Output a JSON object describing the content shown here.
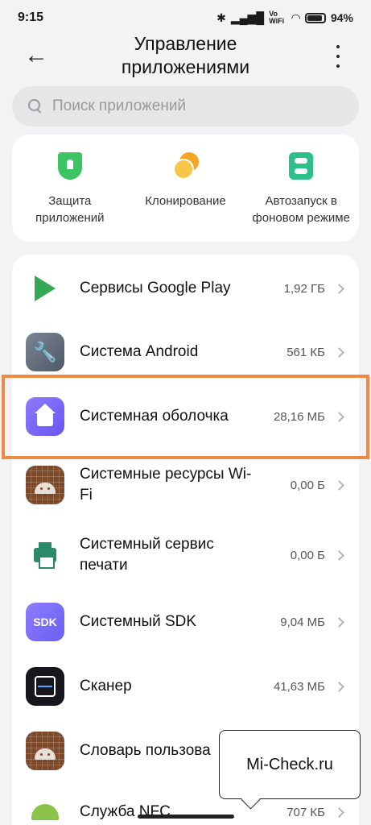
{
  "status_bar": {
    "time": "9:15",
    "network": "Vo WiFi",
    "battery": "94%"
  },
  "header": {
    "title": "Управление приложениями",
    "back_icon": "arrow-left-icon",
    "more_icon": "more-vertical-icon"
  },
  "search": {
    "placeholder": "Поиск приложений"
  },
  "quick_actions": [
    {
      "label": "Защита приложений",
      "icon": "shield-lock-icon",
      "color": "#3cc464"
    },
    {
      "label": "Клонирование",
      "icon": "clone-icon",
      "color": "#f5a623"
    },
    {
      "label": "Автозапуск в фоновом режиме",
      "icon": "autostart-icon",
      "color": "#2fbf8a"
    }
  ],
  "apps": [
    {
      "name": "Сервисы Google Play",
      "size": "1,92 ГБ"
    },
    {
      "name": "Система Android",
      "size": "561 КБ"
    },
    {
      "name": "Системная оболочка",
      "size": "28,16 МБ",
      "highlighted": true
    },
    {
      "name": "Системные ресурсы Wi-Fi",
      "size": "0,00 Б"
    },
    {
      "name": "Системный сервис печати",
      "size": "0,00 Б"
    },
    {
      "name": "Системный SDK",
      "size": "9,04 МБ",
      "icon_text": "SDK"
    },
    {
      "name": "Сканер",
      "size": "41,63 МБ"
    },
    {
      "name": "Словарь пользова",
      "size": ""
    },
    {
      "name": "Служба NFC",
      "size": "707 КБ"
    }
  ],
  "tooltip": {
    "text": "Mi-Check.ru"
  },
  "colors": {
    "highlight": "#ef8a45",
    "accent": "#6a56f0"
  }
}
